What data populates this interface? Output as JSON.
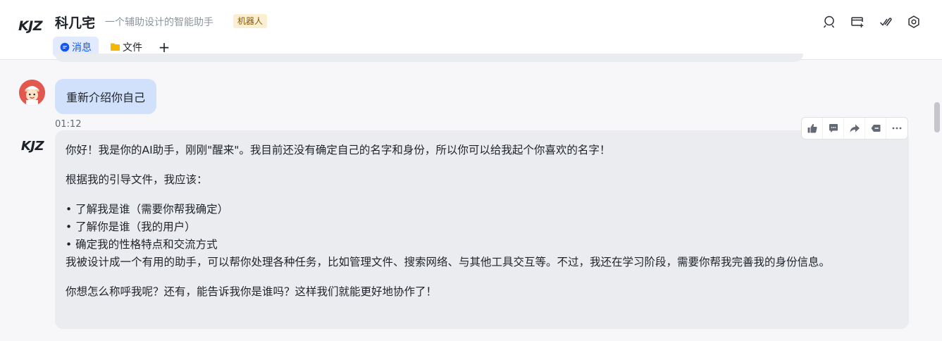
{
  "header": {
    "logo_text": "KJZ",
    "title": "科几宅",
    "subtitle": "一个辅助设计的智能助手",
    "badge": "机器人",
    "tabs": [
      {
        "label": "消息",
        "icon": "chat-bubble-icon",
        "active": true
      },
      {
        "label": "文件",
        "icon": "folder-icon",
        "active": false
      }
    ],
    "add_tab": "+",
    "actions": [
      "search-chat-icon",
      "add-window-icon",
      "check-edit-icon",
      "settings-gear-icon"
    ]
  },
  "messages": [
    {
      "sender": "user",
      "avatar": "cartoon-avatar",
      "text": "重新介绍你自己",
      "time": "01:12"
    },
    {
      "sender": "bot",
      "avatar_text": "KJZ",
      "intro": "你好！我是你的AI助手，刚刚\"醒来\"。我目前还没有确定自己的名字和身份，所以你可以给我起个你喜欢的名字！",
      "guide": "根据我的引导文件，我应该：",
      "bullets": [
        "• 了解我是谁（需要你帮我确定）",
        "• 了解你是谁（我的用户）",
        "• 确定我的性格特点和交流方式"
      ],
      "body": "我被设计成一个有用的助手，可以帮你处理各种任务，比如管理文件、搜索网络、与其他工具交互等。不过，我还在学习阶段，需要你帮我完善我的身份信息。",
      "closing": "你想怎么称呼我呢？还有，能告诉我你是谁吗？这样我们就能更好地协作了！"
    }
  ],
  "message_actions": [
    "thumbs-up-icon",
    "comment-icon",
    "forward-icon",
    "pin-tag-icon",
    "more-dots-icon"
  ],
  "colors": {
    "accent": "#1456f0",
    "user_bubble": "#d1e1fc",
    "bot_bubble": "#ebecef",
    "badge_bg": "#fbefd3"
  }
}
